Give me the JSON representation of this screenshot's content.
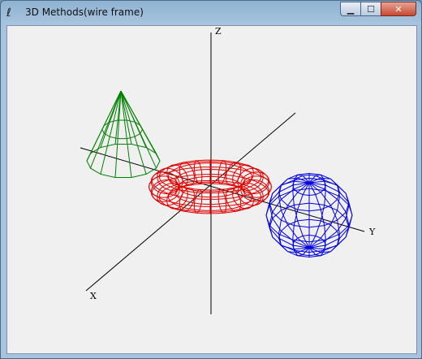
{
  "window": {
    "title": "3D Methods(wire frame)",
    "buttons": {
      "minimize": "▁",
      "maximize": "☐",
      "close": "✕"
    }
  },
  "scene": {
    "axes": {
      "x_label": "X",
      "y_label": "Y",
      "z_label": "Z"
    },
    "objects": [
      {
        "name": "cone",
        "color": "#008000"
      },
      {
        "name": "torus",
        "color": "#e00000"
      },
      {
        "name": "sphere",
        "color": "#0000e0"
      }
    ]
  }
}
